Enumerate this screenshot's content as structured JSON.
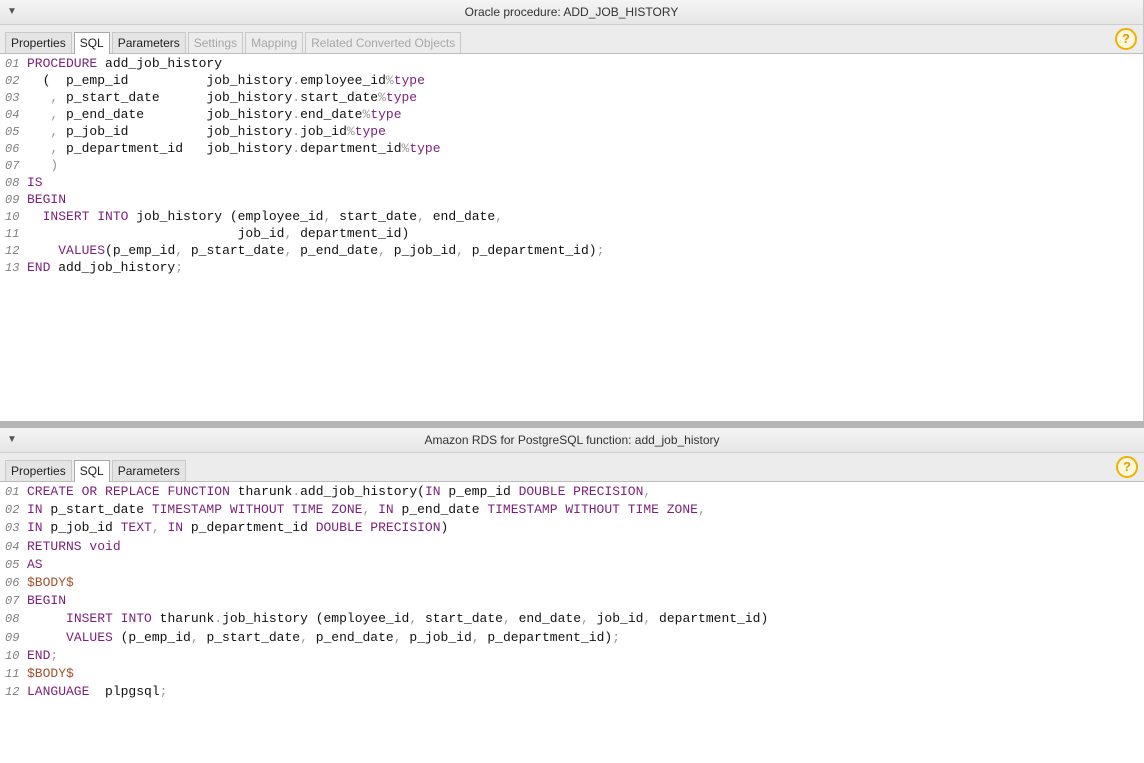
{
  "top_panel": {
    "title": "Oracle procedure: ADD_JOB_HISTORY",
    "tabs": [
      {
        "label": "Properties",
        "state": "normal"
      },
      {
        "label": "SQL",
        "state": "active"
      },
      {
        "label": "Parameters",
        "state": "normal"
      },
      {
        "label": "Settings",
        "state": "disabled"
      },
      {
        "label": "Mapping",
        "state": "disabled"
      },
      {
        "label": "Related Converted Objects",
        "state": "disabled"
      }
    ],
    "code_lines": [
      {
        "num": "01",
        "tokens": [
          [
            "kw",
            "PROCEDURE"
          ],
          [
            "t",
            " add_job_history"
          ]
        ]
      },
      {
        "num": "02",
        "tokens": [
          [
            "t",
            "  (  p_emp_id          job_history"
          ],
          [
            "pu",
            "."
          ],
          [
            "t",
            "employee_id"
          ],
          [
            "pu",
            "%"
          ],
          [
            "kw",
            "type"
          ]
        ]
      },
      {
        "num": "03",
        "tokens": [
          [
            "t",
            "   "
          ],
          [
            "pu",
            ","
          ],
          [
            "t",
            " p_start_date      job_history"
          ],
          [
            "pu",
            "."
          ],
          [
            "t",
            "start_date"
          ],
          [
            "pu",
            "%"
          ],
          [
            "kw",
            "type"
          ]
        ]
      },
      {
        "num": "04",
        "tokens": [
          [
            "t",
            "   "
          ],
          [
            "pu",
            ","
          ],
          [
            "t",
            " p_end_date        job_history"
          ],
          [
            "pu",
            "."
          ],
          [
            "t",
            "end_date"
          ],
          [
            "pu",
            "%"
          ],
          [
            "kw",
            "type"
          ]
        ]
      },
      {
        "num": "05",
        "tokens": [
          [
            "t",
            "   "
          ],
          [
            "pu",
            ","
          ],
          [
            "t",
            " p_job_id          job_history"
          ],
          [
            "pu",
            "."
          ],
          [
            "t",
            "job_id"
          ],
          [
            "pu",
            "%"
          ],
          [
            "kw",
            "type"
          ]
        ]
      },
      {
        "num": "06",
        "tokens": [
          [
            "t",
            "   "
          ],
          [
            "pu",
            ","
          ],
          [
            "t",
            " p_department_id   job_history"
          ],
          [
            "pu",
            "."
          ],
          [
            "t",
            "department_id"
          ],
          [
            "pu",
            "%"
          ],
          [
            "kw",
            "type"
          ]
        ]
      },
      {
        "num": "07",
        "tokens": [
          [
            "pu",
            "   )"
          ]
        ]
      },
      {
        "num": "08",
        "tokens": [
          [
            "kw",
            "IS"
          ]
        ]
      },
      {
        "num": "09",
        "tokens": [
          [
            "kw",
            "BEGIN"
          ]
        ]
      },
      {
        "num": "10",
        "tokens": [
          [
            "t",
            "  "
          ],
          [
            "kw",
            "INSERT INTO"
          ],
          [
            "t",
            " job_history (employee_id"
          ],
          [
            "pu",
            ","
          ],
          [
            "t",
            " start_date"
          ],
          [
            "pu",
            ","
          ],
          [
            "t",
            " end_date"
          ],
          [
            "pu",
            ","
          ]
        ]
      },
      {
        "num": "11",
        "tokens": [
          [
            "t",
            "                           job_id"
          ],
          [
            "pu",
            ","
          ],
          [
            "t",
            " department_id)"
          ]
        ]
      },
      {
        "num": "12",
        "tokens": [
          [
            "t",
            "    "
          ],
          [
            "kw",
            "VALUES"
          ],
          [
            "t",
            "(p_emp_id"
          ],
          [
            "pu",
            ","
          ],
          [
            "t",
            " p_start_date"
          ],
          [
            "pu",
            ","
          ],
          [
            "t",
            " p_end_date"
          ],
          [
            "pu",
            ","
          ],
          [
            "t",
            " p_job_id"
          ],
          [
            "pu",
            ","
          ],
          [
            "t",
            " p_department_id)"
          ],
          [
            "pu",
            ";"
          ]
        ]
      },
      {
        "num": "13",
        "tokens": [
          [
            "kw",
            "END"
          ],
          [
            "t",
            " add_job_history"
          ],
          [
            "pu",
            ";"
          ]
        ]
      }
    ]
  },
  "bottom_panel": {
    "title": "Amazon RDS for PostgreSQL function: add_job_history",
    "tabs": [
      {
        "label": "Properties",
        "state": "normal"
      },
      {
        "label": "SQL",
        "state": "active"
      },
      {
        "label": "Parameters",
        "state": "normal"
      }
    ],
    "code_lines": [
      {
        "num": "01",
        "tokens": [
          [
            "kw",
            "CREATE"
          ],
          [
            "t",
            " "
          ],
          [
            "kw",
            "OR"
          ],
          [
            "t",
            " "
          ],
          [
            "kw",
            "REPLACE"
          ],
          [
            "t",
            " "
          ],
          [
            "kw",
            "FUNCTION"
          ],
          [
            "t",
            " tharunk"
          ],
          [
            "pu",
            "."
          ],
          [
            "t",
            "add_job_history("
          ],
          [
            "kw",
            "IN"
          ],
          [
            "t",
            " p_emp_id "
          ],
          [
            "kw",
            "DOUBLE PRECISION"
          ],
          [
            "pu",
            ","
          ]
        ]
      },
      {
        "num": "02",
        "tokens": [
          [
            "kw",
            "IN"
          ],
          [
            "t",
            " p_start_date "
          ],
          [
            "kw",
            "TIMESTAMP WITHOUT TIME ZONE"
          ],
          [
            "pu",
            ","
          ],
          [
            "t",
            " "
          ],
          [
            "kw",
            "IN"
          ],
          [
            "t",
            " p_end_date "
          ],
          [
            "kw",
            "TIMESTAMP WITHOUT TIME ZONE"
          ],
          [
            "pu",
            ","
          ]
        ]
      },
      {
        "num": "03",
        "tokens": [
          [
            "kw",
            "IN"
          ],
          [
            "t",
            " p_job_id "
          ],
          [
            "kw",
            "TEXT"
          ],
          [
            "pu",
            ","
          ],
          [
            "t",
            " "
          ],
          [
            "kw",
            "IN"
          ],
          [
            "t",
            " p_department_id "
          ],
          [
            "kw",
            "DOUBLE PRECISION"
          ],
          [
            "t",
            ")"
          ]
        ]
      },
      {
        "num": "04",
        "tokens": [
          [
            "kw",
            "RETURNS"
          ],
          [
            "t",
            " "
          ],
          [
            "kw",
            "void"
          ]
        ]
      },
      {
        "num": "05",
        "tokens": [
          [
            "kw",
            "AS"
          ]
        ]
      },
      {
        "num": "06",
        "tokens": [
          [
            "bl",
            "$BODY$"
          ]
        ]
      },
      {
        "num": "07",
        "tokens": [
          [
            "kw",
            "BEGIN"
          ]
        ]
      },
      {
        "num": "08",
        "tokens": [
          [
            "t",
            "     "
          ],
          [
            "kw",
            "INSERT"
          ],
          [
            "t",
            " "
          ],
          [
            "kw",
            "INTO"
          ],
          [
            "t",
            " tharunk"
          ],
          [
            "pu",
            "."
          ],
          [
            "t",
            "job_history (employee_id"
          ],
          [
            "pu",
            ","
          ],
          [
            "t",
            " start_date"
          ],
          [
            "pu",
            ","
          ],
          [
            "t",
            " end_date"
          ],
          [
            "pu",
            ","
          ],
          [
            "t",
            " job_id"
          ],
          [
            "pu",
            ","
          ],
          [
            "t",
            " department_id)"
          ]
        ]
      },
      {
        "num": "09",
        "tokens": [
          [
            "t",
            "     "
          ],
          [
            "kw",
            "VALUES"
          ],
          [
            "t",
            " (p_emp_id"
          ],
          [
            "pu",
            ","
          ],
          [
            "t",
            " p_start_date"
          ],
          [
            "pu",
            ","
          ],
          [
            "t",
            " p_end_date"
          ],
          [
            "pu",
            ","
          ],
          [
            "t",
            " p_job_id"
          ],
          [
            "pu",
            ","
          ],
          [
            "t",
            " p_department_id)"
          ],
          [
            "pu",
            ";"
          ]
        ]
      },
      {
        "num": "10",
        "tokens": [
          [
            "kw",
            "END"
          ],
          [
            "pu",
            ";"
          ]
        ]
      },
      {
        "num": "11",
        "tokens": [
          [
            "bl",
            "$BODY$"
          ]
        ]
      },
      {
        "num": "12",
        "tokens": [
          [
            "kw",
            "LANGUAGE"
          ],
          [
            "t",
            "  plpgsql"
          ],
          [
            "pu",
            ";"
          ]
        ]
      }
    ]
  },
  "help_icon_text": "?",
  "collapse_icon_text": "▼",
  "colors": {
    "keyword": "#7b1f7b",
    "punctuation": "#999999",
    "body_marker": "#a0522d",
    "line_number": "#7f7f7f"
  }
}
